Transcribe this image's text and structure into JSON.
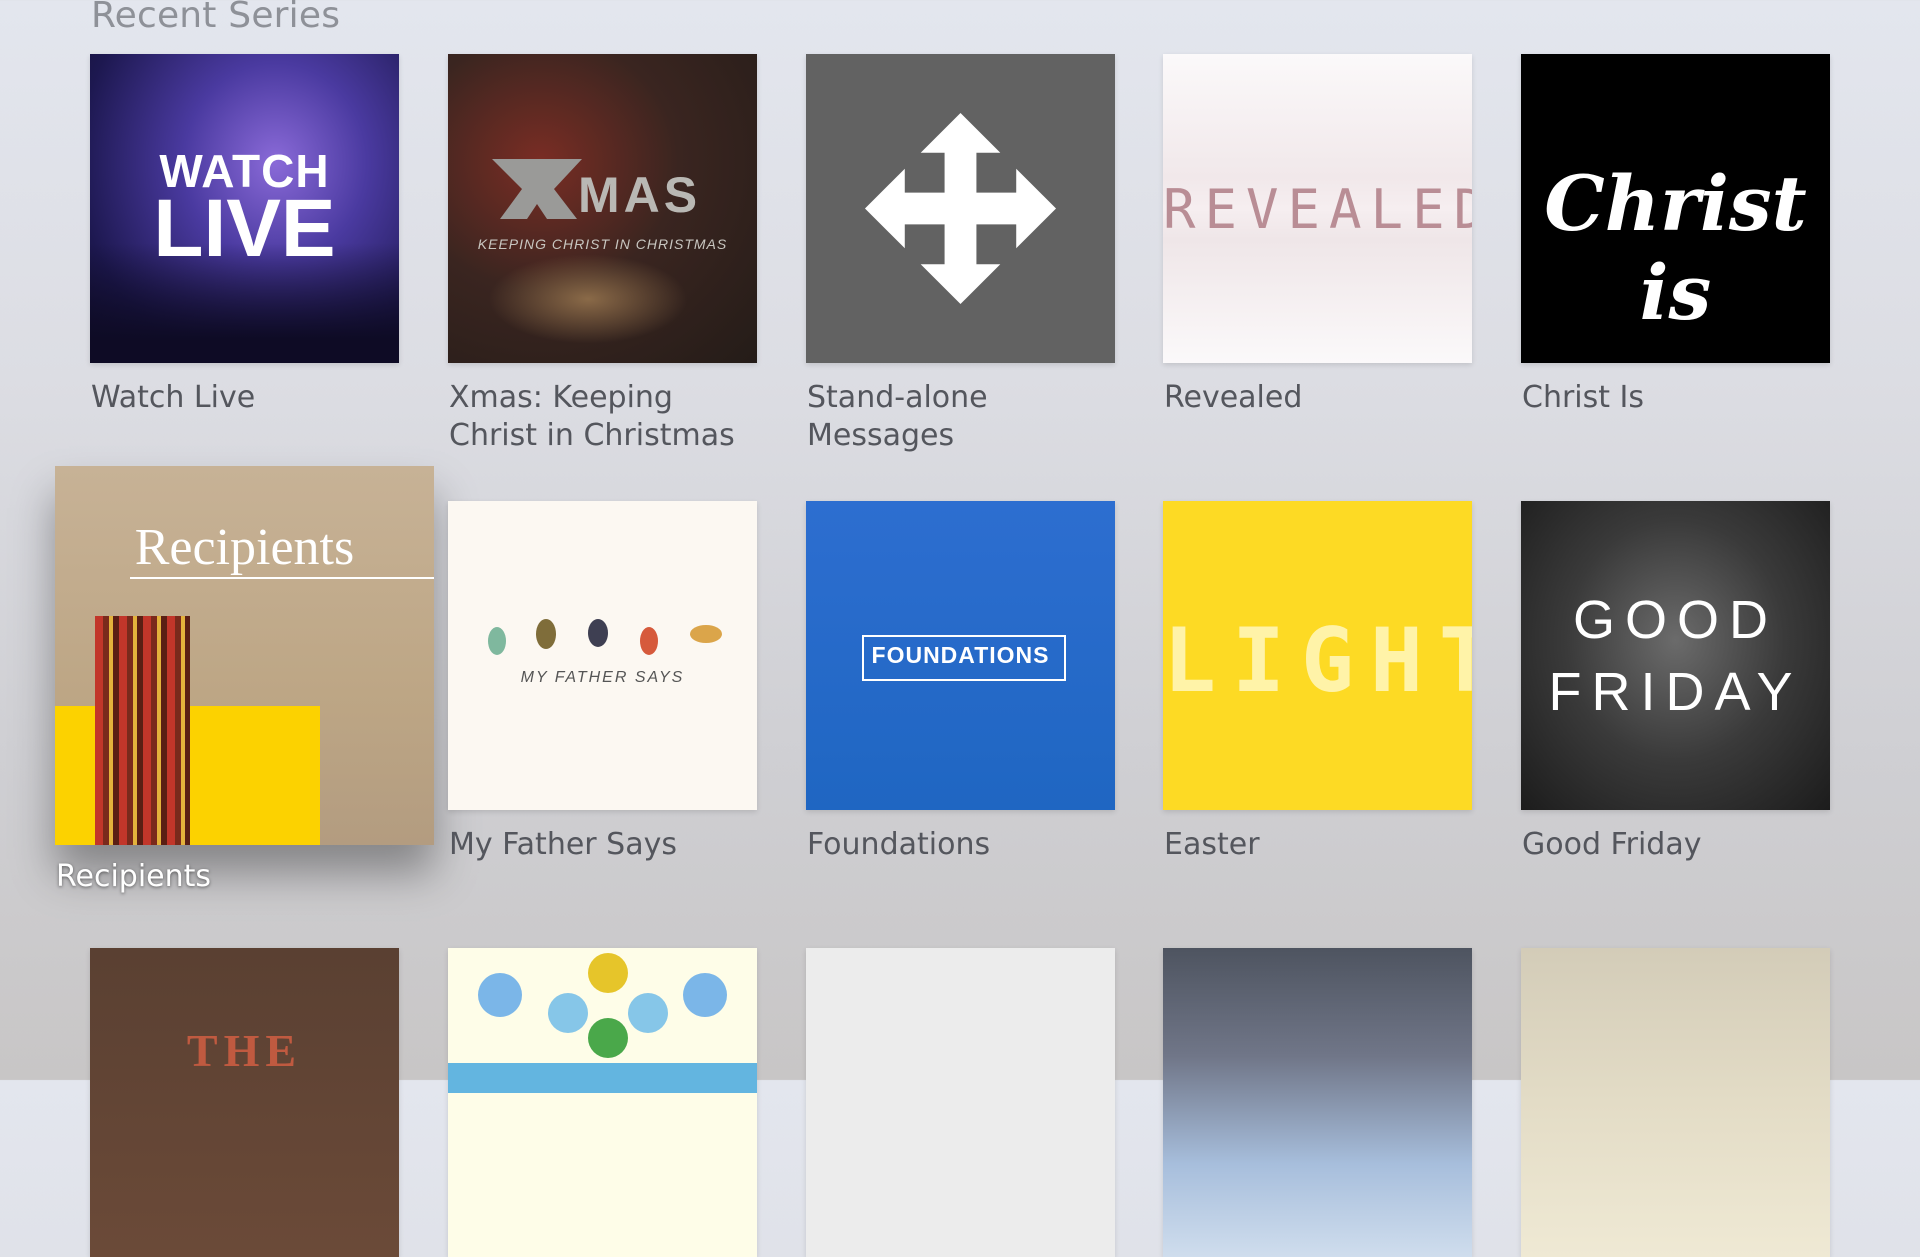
{
  "section": {
    "title": "Recent Series"
  },
  "series": [
    {
      "label": "Watch Live",
      "art": {
        "line1": "WATCH",
        "line2": "LIVE"
      }
    },
    {
      "label": "Xmas: Keeping Christ in Christmas",
      "art": {
        "title": "MAS",
        "subtitle": "KEEPING CHRIST IN CHRISTMAS"
      }
    },
    {
      "label": "Stand-alone Messages",
      "art": {
        "icon": "move-arrows-icon"
      }
    },
    {
      "label": "Revealed",
      "art": {
        "title": "REVEALED"
      }
    },
    {
      "label": "Christ Is",
      "art": {
        "title": "Christ is"
      }
    },
    {
      "label": "Recipients",
      "art": {
        "title": "Recipients"
      },
      "focused": true
    },
    {
      "label": "My Father Says",
      "art": {
        "title": "MY FATHER SAYS"
      }
    },
    {
      "label": "Foundations",
      "art": {
        "title": "FOUNDATIONS"
      }
    },
    {
      "label": "Easter",
      "art": {
        "title": "LIGHT"
      }
    },
    {
      "label": "Good Friday",
      "art": {
        "line1": "GOOD",
        "line2": "FRIDAY"
      }
    },
    {
      "label": "",
      "art": {
        "title": "THE"
      }
    },
    {
      "label": "",
      "art": {}
    },
    {
      "label": "",
      "art": {}
    },
    {
      "label": "",
      "art": {}
    },
    {
      "label": "",
      "art": {}
    }
  ],
  "colors": {
    "foundations": "#1f66c2",
    "easter": "#fdda24",
    "christ_is": "#000000"
  }
}
